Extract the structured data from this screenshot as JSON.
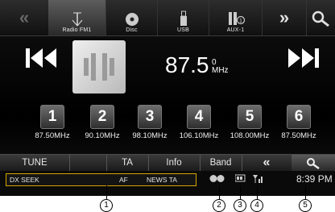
{
  "sources": [
    {
      "label": "Radio FM1",
      "icon": "antenna-icon",
      "active": true
    },
    {
      "label": "Disc",
      "icon": "disc-icon",
      "active": false
    },
    {
      "label": "USB",
      "icon": "usb-icon",
      "active": false
    },
    {
      "label": "AUX-1",
      "icon": "aux-icon",
      "active": false
    }
  ],
  "nav": {
    "left": "«",
    "right": "»"
  },
  "tuner": {
    "frequency": "87.5",
    "unit_top": "0",
    "unit": "MHz"
  },
  "presets": [
    {
      "num": "1",
      "freq": "87.50MHz"
    },
    {
      "num": "2",
      "freq": "90.10MHz"
    },
    {
      "num": "3",
      "freq": "98.10MHz"
    },
    {
      "num": "4",
      "freq": "106.10MHz"
    },
    {
      "num": "5",
      "freq": "108.00MHz"
    },
    {
      "num": "6",
      "freq": "87.50MHz"
    }
  ],
  "functions": {
    "tune": "TUNE",
    "ta": "TA",
    "info": "Info",
    "band": "Band",
    "back": "«"
  },
  "status": {
    "dx_seek": "DX SEEK",
    "af": "AF",
    "news_ta": "NEWS TA",
    "clock": "8:39 PM"
  },
  "callouts": [
    "1",
    "2",
    "3",
    "4",
    "5"
  ],
  "colors": {
    "status_border": "#d8a400"
  }
}
